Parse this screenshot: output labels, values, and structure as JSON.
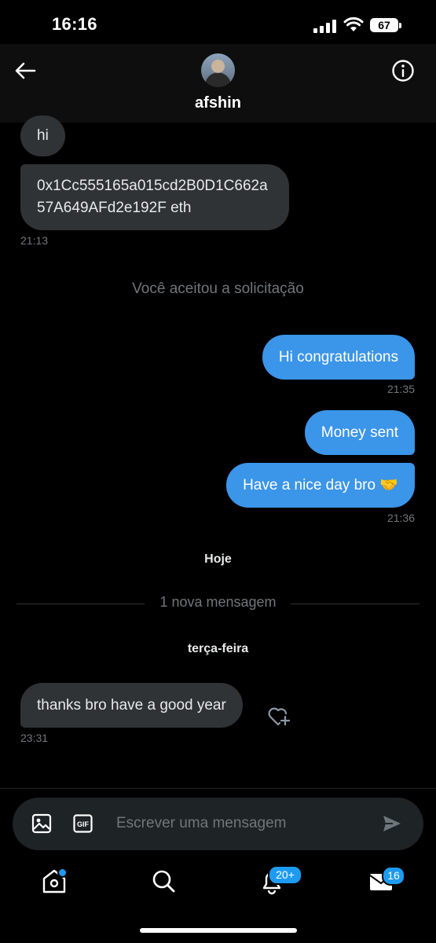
{
  "status_bar": {
    "time": "16:16",
    "battery": "67"
  },
  "header": {
    "contact_name": "afshin"
  },
  "messages": {
    "hi": "hi",
    "eth_address": "0x1Cc555165a015cd2B0D1C662a57A649AFd2e192F eth",
    "time_1": "21:13",
    "system_accepted": "Você aceitou a solicitação",
    "congrats": "Hi congratulations",
    "time_2": "21:35",
    "money_sent": "Money sent",
    "nice_day": "Have a nice day bro 🤝",
    "time_3": "21:36",
    "day_today": "Hoje",
    "new_message": "1 nova mensagem",
    "day_tuesday": "terça-feira",
    "thanks": "thanks bro have a good year",
    "time_4": "23:31"
  },
  "composer": {
    "placeholder": "Escrever uma mensagem"
  },
  "tabbar": {
    "notifications_badge": "20+",
    "messages_badge": "16"
  },
  "colors": {
    "accent": "#1d9bf0",
    "outgoing_bubble": "#3b95e8",
    "incoming_bubble": "#2f3336"
  }
}
